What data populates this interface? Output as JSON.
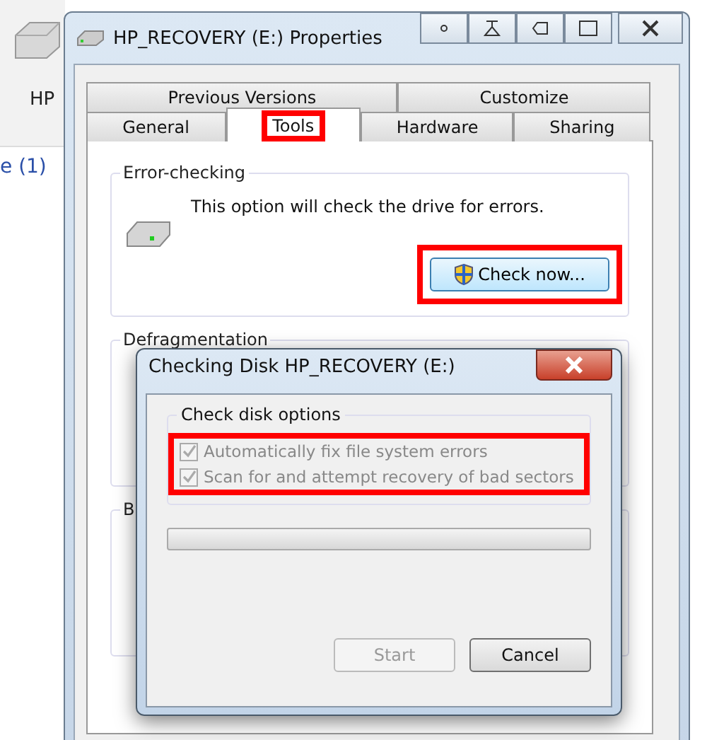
{
  "background": {
    "drive_label": "HP",
    "link_text": "e (1)"
  },
  "properties_window": {
    "title": "HP_RECOVERY (E:) Properties",
    "tab_rows": [
      [
        {
          "label": "Previous Versions",
          "selected": false
        },
        {
          "label": "Customize",
          "selected": false
        }
      ],
      [
        {
          "label": "General",
          "selected": false
        },
        {
          "label": "Tools",
          "selected": true
        },
        {
          "label": "Hardware",
          "selected": false
        },
        {
          "label": "Sharing",
          "selected": false
        }
      ]
    ],
    "error_checking": {
      "title": "Error-checking",
      "description": "This option will check the drive for errors.",
      "button": "Check now..."
    },
    "defragmentation": {
      "title": "Defragmentation"
    },
    "backup": {
      "title": "B"
    }
  },
  "check_disk_dialog": {
    "title": "Checking Disk HP_RECOVERY (E:)",
    "group_title": "Check disk options",
    "options": [
      {
        "label": "Automatically fix file system errors",
        "checked": true,
        "disabled": true
      },
      {
        "label": "Scan for and attempt recovery of bad sectors",
        "checked": true,
        "disabled": true
      }
    ],
    "progress": {
      "level": 0
    },
    "buttons": [
      {
        "label": "Start",
        "disabled": true
      },
      {
        "label": "Cancel",
        "disabled": false
      }
    ]
  }
}
